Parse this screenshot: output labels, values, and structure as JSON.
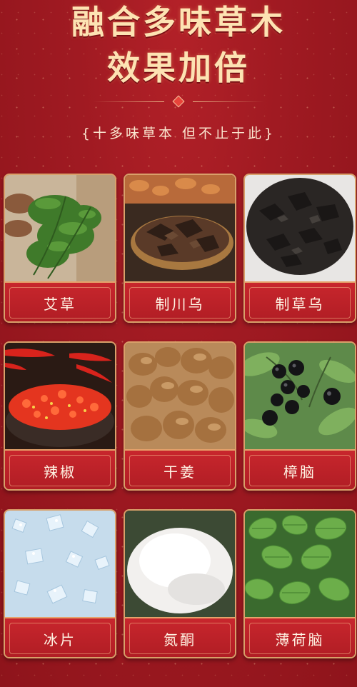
{
  "header": {
    "title_line1": "融合多味草木",
    "title_line2": "效果加倍",
    "subtitle": "{十多味草本 但不止于此}"
  },
  "ingredients": [
    {
      "label": "艾草"
    },
    {
      "label": "制川乌"
    },
    {
      "label": "制草乌"
    },
    {
      "label": "辣椒"
    },
    {
      "label": "干姜"
    },
    {
      "label": "樟脑"
    },
    {
      "label": "冰片"
    },
    {
      "label": "氮酮"
    },
    {
      "label": "薄荷脑"
    }
  ],
  "colors": {
    "background": "#a01a22",
    "title": "#fde3b3",
    "label_bar": "#c8262d",
    "card_border": "#d9a06a"
  }
}
